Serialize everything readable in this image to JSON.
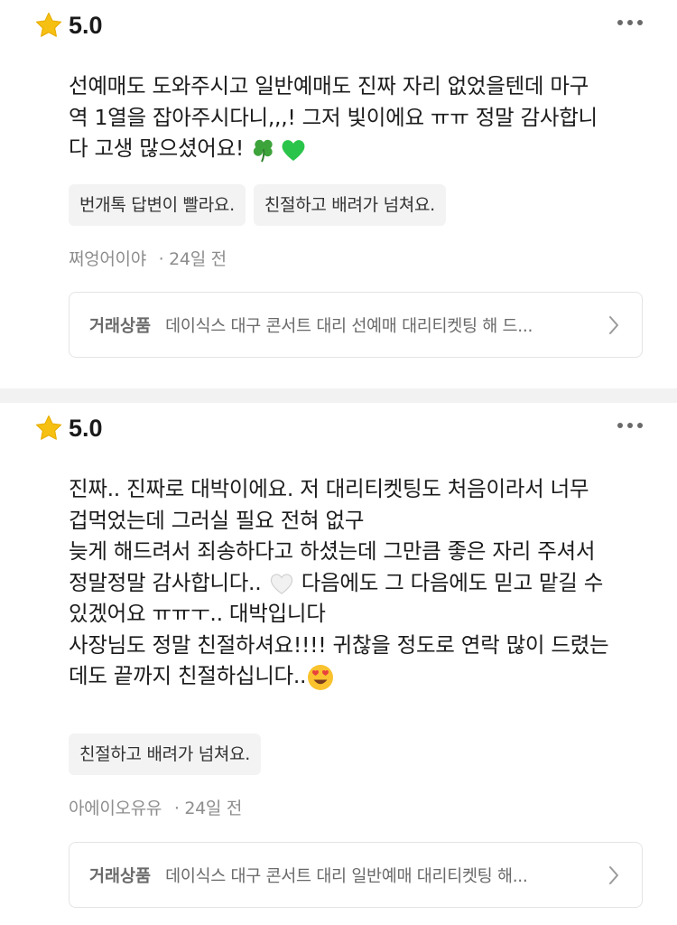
{
  "reviews": [
    {
      "score": "5.0",
      "lines": [
        "선예매도 도와주시고 일반예매도 진짜 자리 없었을텐데 마구",
        "역 1열을 잡아주시다니,,,! 그저 빛이에요 ㅠㅠ 정말 감사합니",
        "다 고생 많으셨어요! "
      ],
      "tags": [
        "번개톡 답변이 빨라요.",
        "친절하고 배려가 넘쳐요."
      ],
      "author": "쩌엉어이야",
      "time": "· 24일 전",
      "product_label": "거래상품",
      "product_title": "데이식스 대구 콘서트 대리 선예매 대리티켓팅 해 드..."
    },
    {
      "score": "5.0",
      "lines": [
        "진짜.. 진짜로 대박이에요. 저 대리티켓팅도 처음이라서 너무",
        "겁먹었는데 그러실 필요 전혀 없구",
        "늦게 해드려서 죄송하다고 하셨는데 그만큼 좋은 자리 주셔서",
        "정말정말 감사합니다.. ",
        " 다음에도 그 다음에도 믿고 맡길 수",
        "있겠어요 ㅠㅠㅜ.. 대박입니다",
        "사장님도 정말 친절하셔요!!!! 귀찮을 정도로 연락 많이 드렸는",
        "데도 끝까지 친절하십니다.."
      ],
      "tags": [
        "친절하고 배려가 넘쳐요."
      ],
      "author": "아에이오유유",
      "time": "· 24일 전",
      "product_label": "거래상품",
      "product_title": "데이식스 대구 콘서트 대리 일반예매 대리티켓팅 해..."
    }
  ],
  "colors": {
    "star": "#f6c012",
    "clover": "#3da33b",
    "green_heart": "#2bc44a",
    "white_heart": "#ececec",
    "divider": "#f2f2f2"
  },
  "icons": [
    "star-icon",
    "more-icon",
    "clover-emoji",
    "green-heart-emoji",
    "white-heart-emoji",
    "heart-eyes-emoji",
    "chevron-right-icon"
  ]
}
